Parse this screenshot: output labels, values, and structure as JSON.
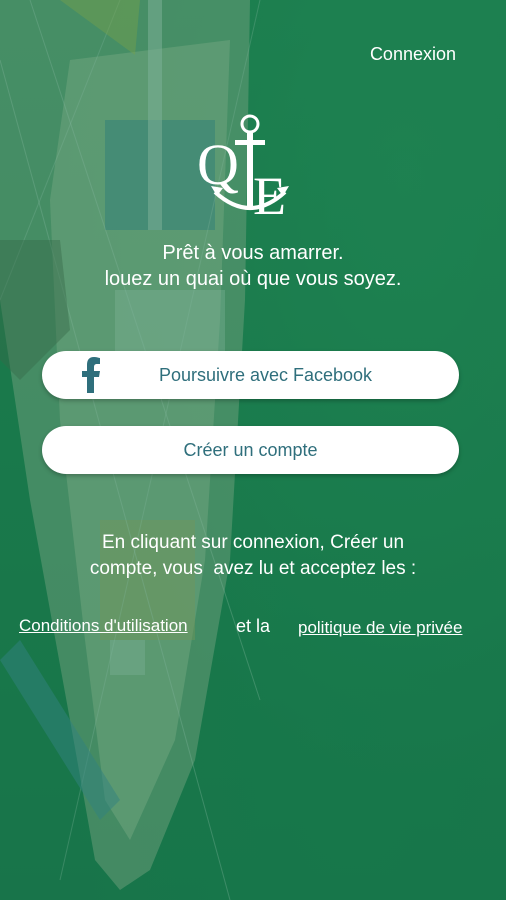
{
  "header": {
    "login_label": "Connexion"
  },
  "logo": {
    "icon": "anchor-logo-icon",
    "letters": "QE"
  },
  "tagline": {
    "line1": "Prêt à vous amarrer.",
    "line2": "louez un quai où que vous soyez."
  },
  "buttons": {
    "facebook_label": "Poursuivre avec Facebook",
    "facebook_icon": "facebook-icon",
    "create_account_label": "Créer un compte"
  },
  "terms": {
    "line1": "En cliquant sur connexion, Créer un",
    "line2": "compte, vous  avez lu et acceptez les :",
    "conditions_link": "Conditions d'utilisation",
    "and_text": "et la",
    "privacy_link": "politique de vie privée"
  },
  "colors": {
    "background_green": "#1c7a4f",
    "button_text": "#2f6f7c",
    "facebook_blue": "#2f6f7c",
    "text_white": "#ffffff"
  }
}
